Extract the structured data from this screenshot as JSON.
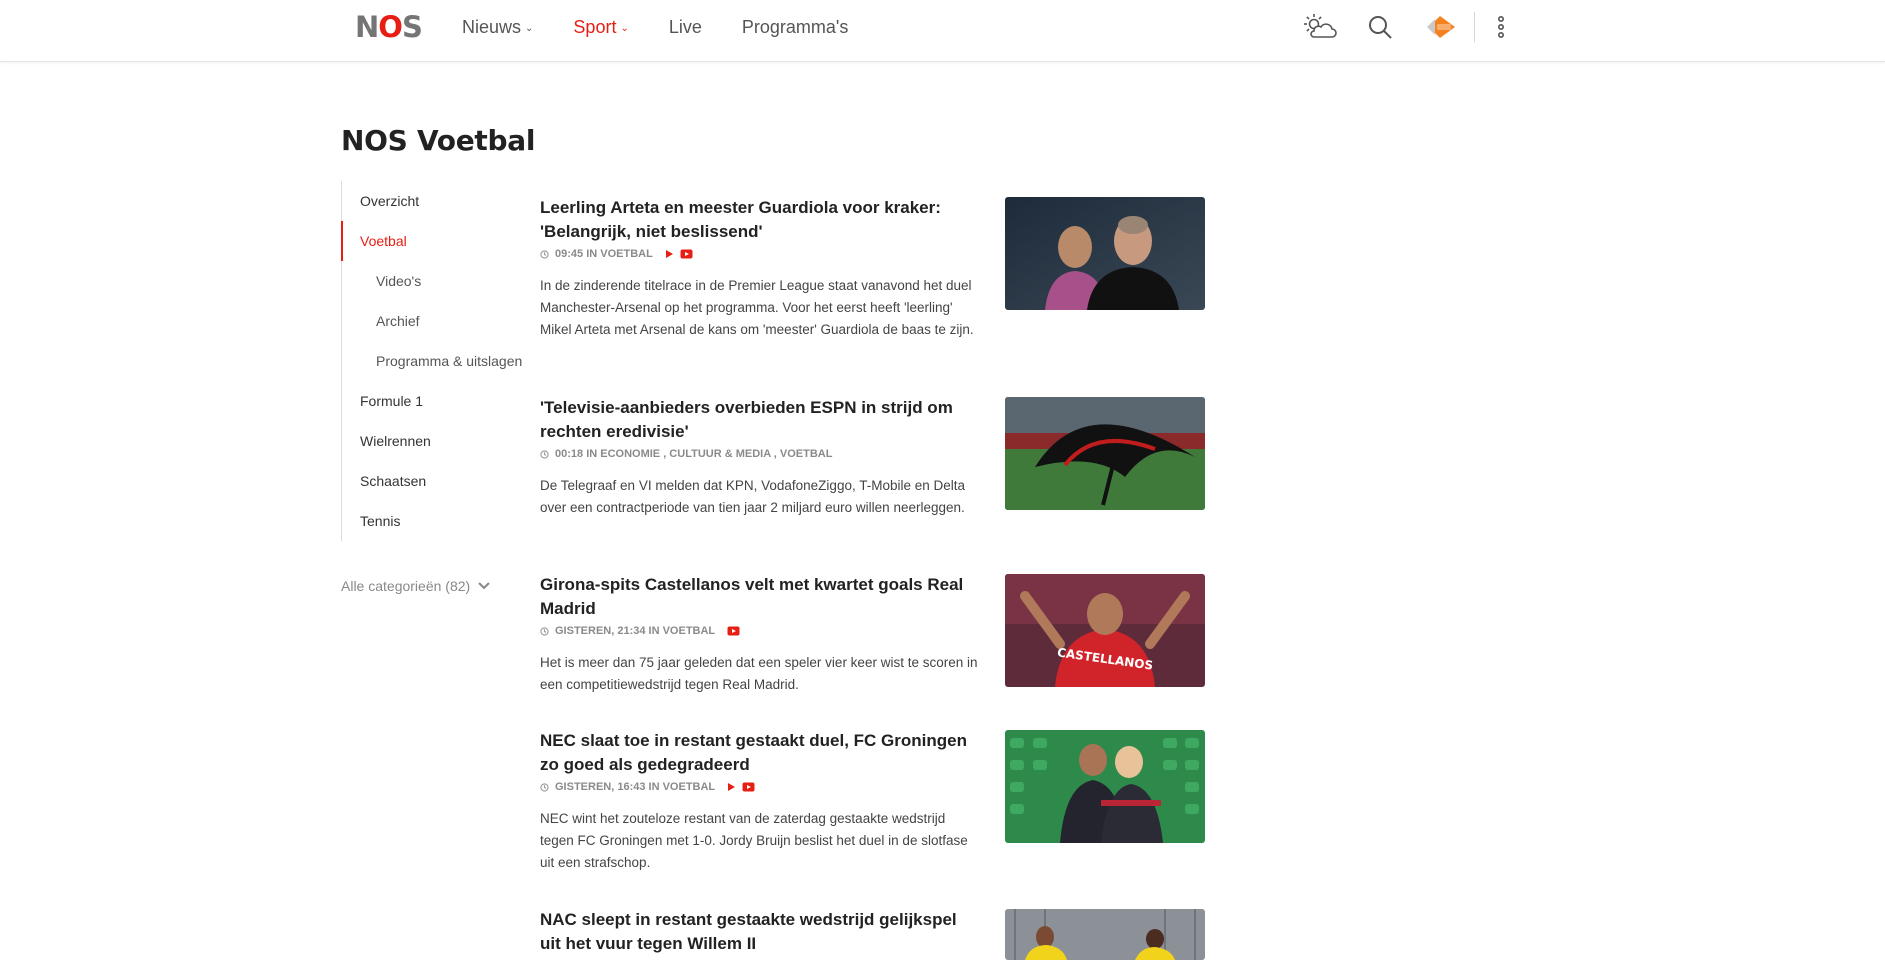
{
  "brand": {
    "logo_n": "N",
    "logo_o": "O",
    "logo_s": "S",
    "accent": "#e61e14"
  },
  "nav": {
    "items": [
      {
        "label": "Nieuws",
        "chevron": "⌄"
      },
      {
        "label": "Sport",
        "chevron": "⌄"
      },
      {
        "label": "Live"
      },
      {
        "label": "Programma's"
      }
    ]
  },
  "header_icons": [
    "weather-icon",
    "search-icon",
    "npo-start-icon",
    "more-vertical-icon"
  ],
  "page": {
    "title": "NOS Voetbal"
  },
  "sidebar": {
    "items": [
      {
        "label": "Overzicht"
      },
      {
        "label": "Voetbal"
      },
      {
        "label": "Video's"
      },
      {
        "label": "Archief"
      },
      {
        "label": "Programma & uitslagen"
      },
      {
        "label": "Formule 1"
      },
      {
        "label": "Wielrennen"
      },
      {
        "label": "Schaatsen"
      },
      {
        "label": "Tennis"
      }
    ],
    "all_categories": "Alle categorieën (82)"
  },
  "articles": [
    {
      "title": "Leerling Arteta en meester Guardiola voor kraker: 'Belangrijk, niet beslissend'",
      "meta": "09:45 IN VOETBAL",
      "text": "In de zinderende titelrace in de Premier League staat vanavond het duel Manchester-Arsenal op het programma. Voor het eerst heeft 'leerling' Mikel Arteta met Arsenal de kans om 'meester' Guardiola de baas te zijn."
    },
    {
      "title": "'Televisie-aanbieders overbieden ESPN in strijd om rechten eredivisie'",
      "meta": "00:18 IN ECONOMIE , CULTUUR & MEDIA , VOETBAL",
      "text": "De Telegraaf en VI melden dat KPN, VodafoneZiggo, T-Mobile en Delta over een contractperiode van tien jaar 2 miljard euro willen neerleggen."
    },
    {
      "title": "Girona-spits Castellanos velt met kwartet goals Real Madrid",
      "meta": "GISTEREN, 21:34 IN VOETBAL",
      "text": "Het is meer dan 75 jaar geleden dat een speler vier keer wist te scoren in een competitiewedstrijd tegen Real Madrid.",
      "shirt_text": "CASTELLANOS"
    },
    {
      "title": "NEC slaat toe in restant gestaakt duel, FC Groningen zo goed als gedegradeerd",
      "meta": "GISTEREN, 16:43 IN VOETBAL",
      "text": "NEC wint het zouteloze restant van de zaterdag gestaakte wedstrijd tegen FC Groningen met 1-0. Jordy Bruijn beslist het duel in de slotfase uit een strafschop."
    },
    {
      "title": "NAC sleept in restant gestaakte wedstrijd gelijkspel uit het vuur tegen Willem II",
      "meta": "",
      "text": ""
    }
  ]
}
